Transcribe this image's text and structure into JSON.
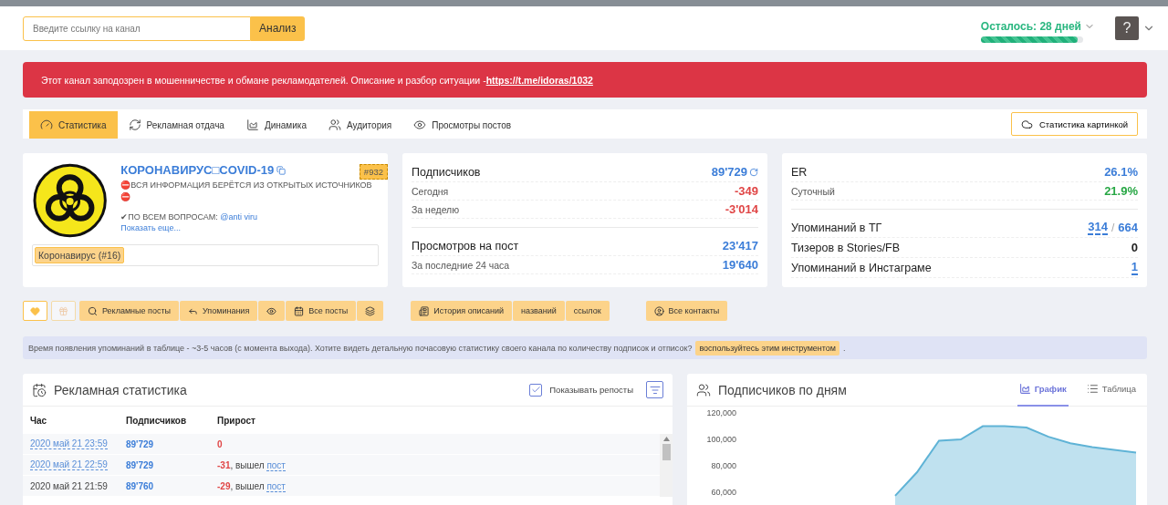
{
  "header": {
    "search": {
      "placeholder": "Введите ссылку на канал"
    },
    "analyze_button": "Анализ",
    "subscription": {
      "label": "Осталось: 28 дней",
      "level": 0.95
    },
    "help_button": "?"
  },
  "alert": {
    "text": "Этот канал заподозрен в мошенничестве и обмане рекламодателей. Описание и разбор ситуации -",
    "link": "https://t.me/idoras/1032"
  },
  "tabs": [
    {
      "label": "Статистика",
      "selected": true
    },
    {
      "label": "Рекламная отдача",
      "selected": false
    },
    {
      "label": "Динамика",
      "selected": false
    },
    {
      "label": "Аудитория",
      "selected": false
    },
    {
      "label": "Просмотры постов",
      "selected": false
    }
  ],
  "image_stats_button": "Статистика картинкой",
  "channel": {
    "title": "КОРОНАВИРУС□COVID-19",
    "rank": "#932",
    "description": "⛔ВСЯ ИНФОРМАЦИЯ БЕРЁТСЯ ИЗ ОТКРЫТЫХ ИСТОЧНИКОВ ⛔",
    "contact_text": "✔ПО ВСЕМ ВОПРОСАМ: ",
    "contact_link": "@anti viru",
    "show_more": "Показать еще...",
    "categories": [
      "Коронавирус (#16)"
    ]
  },
  "subscriber_stats": [
    [
      {
        "kind": "main",
        "label": "Подписчиков",
        "values": [
          {
            "text": "89'729",
            "color": "#3b7dd8",
            "dotted": false
          }
        ],
        "refresh": true
      },
      {
        "kind": "sub",
        "label": "Сегодня",
        "values": [
          {
            "text": "-349",
            "color": "#e04646",
            "dotted": false
          }
        ]
      },
      {
        "kind": "sub",
        "label": "За неделю",
        "values": [
          {
            "text": "-3'014",
            "color": "#e04646",
            "dotted": false
          }
        ]
      }
    ],
    [
      {
        "kind": "main",
        "label": "Просмотров на пост",
        "values": [
          {
            "text": "23'417",
            "color": "#3b7dd8",
            "dotted": false
          }
        ]
      },
      {
        "kind": "sub",
        "label": "За последние 24 часа",
        "values": [
          {
            "text": "19'640",
            "color": "#3b7dd8",
            "dotted": false
          }
        ]
      }
    ]
  ],
  "engagement_stats": [
    [
      {
        "kind": "main",
        "label": "ER",
        "values": [
          {
            "text": "26.1%",
            "color": "#3b7dd8",
            "dotted": false
          }
        ]
      },
      {
        "kind": "sub",
        "label": "Суточный",
        "values": [
          {
            "text": "21.9%",
            "color": "#28a745",
            "dotted": false
          }
        ]
      }
    ],
    [
      {
        "kind": "main",
        "label": "Упоминаний в ТГ",
        "values": [
          {
            "text": "314",
            "color": "#3b7dd8",
            "dotted": true
          },
          {
            "text": "664",
            "color": "#3b7dd8",
            "dotted": false
          }
        ],
        "separator": "/"
      },
      {
        "kind": "main",
        "label": "Тизеров в Stories/FB",
        "values": [
          {
            "text": "0",
            "color": "#222222",
            "dotted": false
          }
        ]
      },
      {
        "kind": "main",
        "label": "Упоминаний в Инстаграме",
        "values": [
          {
            "text": "1",
            "color": "#3b7dd8",
            "dotted": true
          }
        ]
      }
    ]
  ],
  "action_groups": [
    [
      {
        "kind": "icon",
        "disabled": false
      }
    ],
    [
      {
        "kind": "icon",
        "disabled": true
      }
    ],
    [
      {
        "kind": "label",
        "label": "Рекламные посты",
        "disabled": false
      },
      {
        "kind": "label",
        "label": "Упоминания",
        "disabled": false
      },
      {
        "kind": "icon",
        "disabled": false
      },
      {
        "kind": "label",
        "label": "Все посты",
        "disabled": false
      },
      {
        "kind": "icon",
        "disabled": false
      }
    ],
    [
      {
        "kind": "label",
        "label": "История описаний",
        "disabled": false
      },
      {
        "kind": "label",
        "label": "названий",
        "disabled": false
      },
      {
        "kind": "label",
        "label": "ссылок",
        "disabled": false
      }
    ],
    [
      {
        "kind": "label",
        "label": "Все контакты",
        "disabled": false
      }
    ]
  ],
  "info": {
    "text": "Время появления упоминаний в таблице - ~3-5 часов (с момента выхода). Хотите видеть детальную почасовую статистику своего канала по количеству подписок и отписок?",
    "button": "воспользуйтесь этим инструментом",
    "tail": "."
  },
  "ad_stats": {
    "title": "Рекламная статистика",
    "repost_checkbox": {
      "label": "Показывать репосты",
      "checked": true
    },
    "columns": [
      "Час",
      "Подписчиков",
      "Прирост"
    ],
    "rows": [
      {
        "hour": "2020 май 21 23:59",
        "hour_link": true,
        "subscribers": "89'729",
        "growth": "0"
      },
      {
        "hour": "2020 май 21 22:59",
        "hour_link": true,
        "subscribers": "89'729",
        "growth": "-31",
        "note": ", вышел",
        "post_link": "пост"
      },
      {
        "hour": "2020 май 21 21:59",
        "hour_link": false,
        "subscribers": "89'760",
        "growth": "-29",
        "note": ", вышел",
        "post_link": "пост"
      }
    ]
  },
  "daily_subscribers": {
    "title": "Подписчиков по дням",
    "views": [
      {
        "label": "График",
        "selected": true
      },
      {
        "label": "Таблица",
        "selected": false
      }
    ],
    "y_axis_labels": [
      "120,000",
      "100,000",
      "80,000",
      "60,000"
    ]
  }
}
